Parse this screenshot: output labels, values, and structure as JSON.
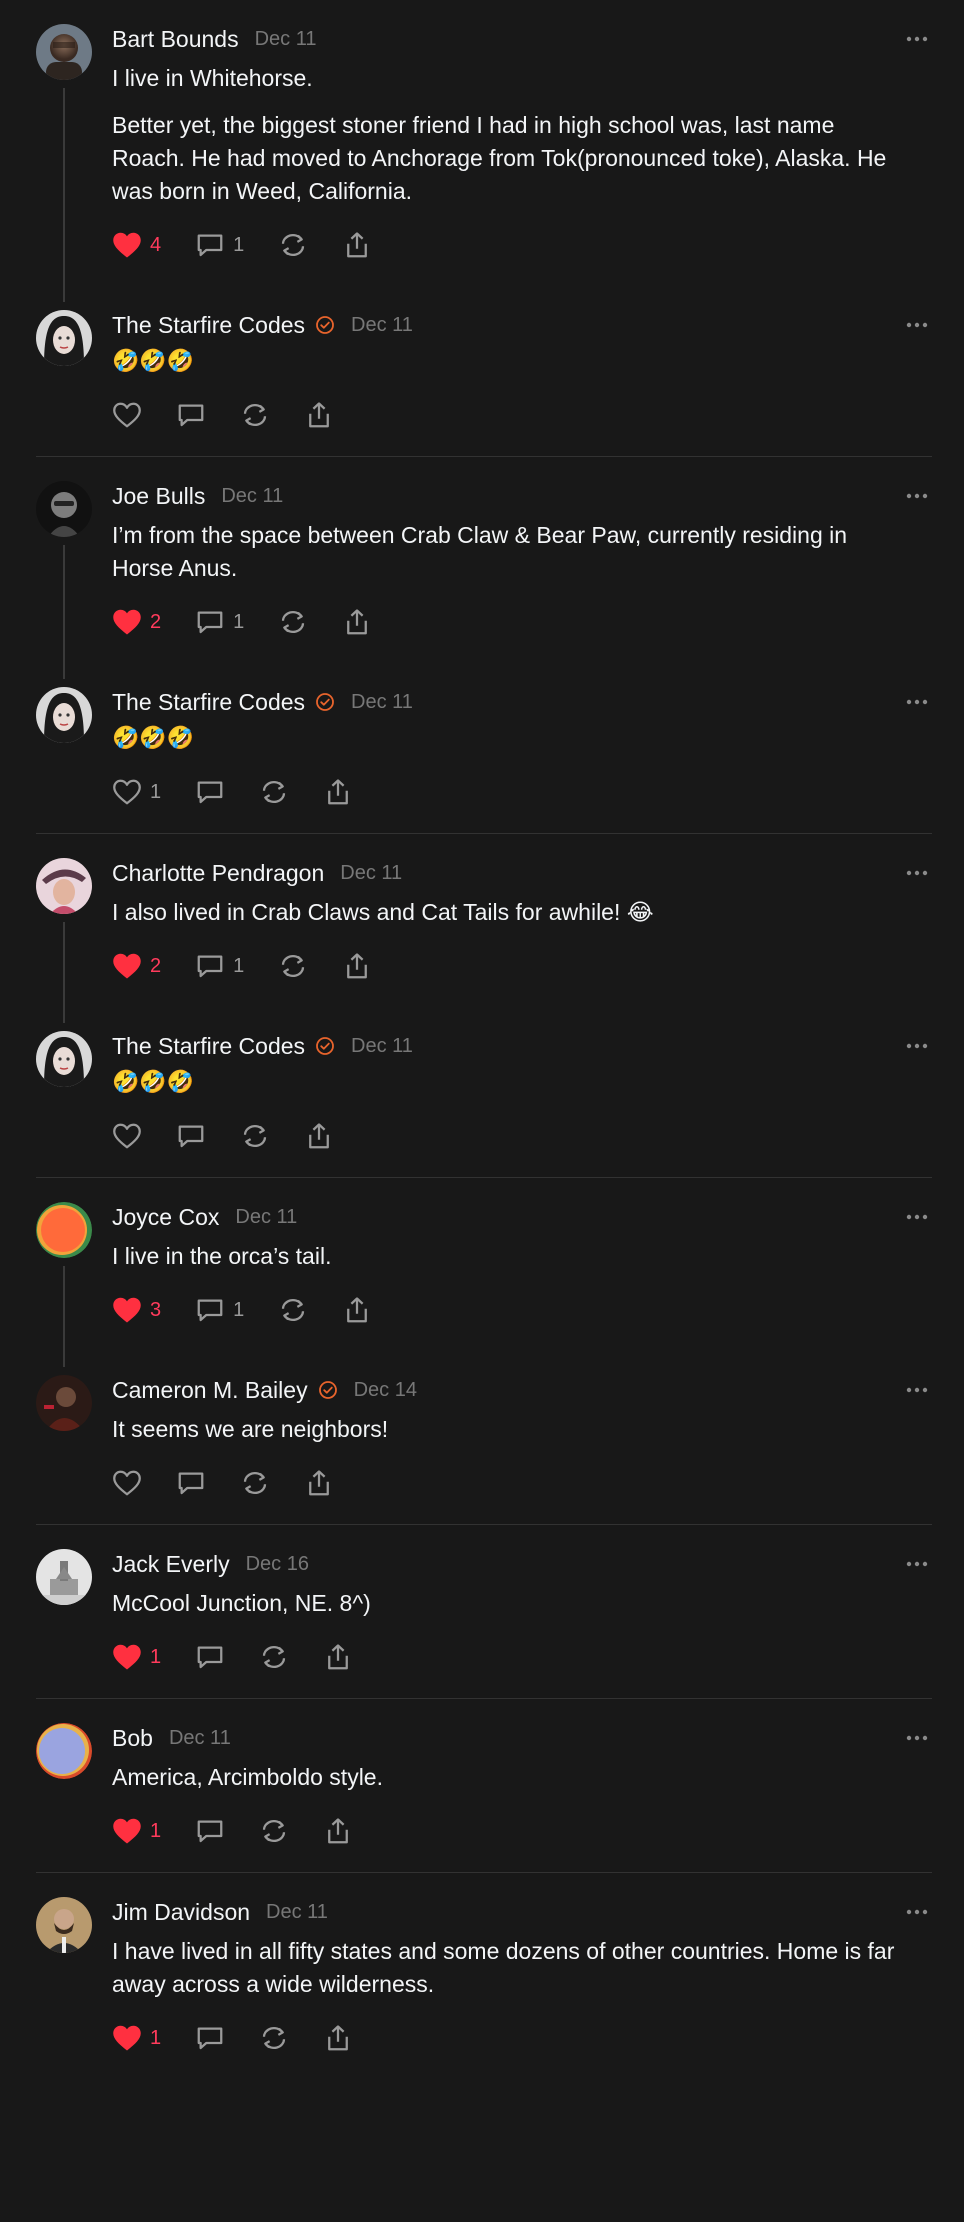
{
  "colors": {
    "background": "#181818",
    "like": "#ff3040",
    "verified": "#e8642c",
    "muted": "#777777"
  },
  "threads": [
    {
      "posts": [
        {
          "author": "Bart Bounds",
          "date": "Dec 11",
          "verified": false,
          "text": [
            "I live in Whitehorse.",
            "Better yet, the biggest stoner friend I had in high school was, last name Roach. He had moved to Anchorage from Tok(pronounced toke), Alaska. He was born in Weed, California."
          ],
          "likes": "4",
          "liked": true,
          "replies": "1"
        },
        {
          "author": "The Starfire Codes",
          "date": "Dec 11",
          "verified": true,
          "text": [
            "🤣🤣🤣"
          ],
          "likes": "",
          "liked": false,
          "replies": ""
        }
      ]
    },
    {
      "posts": [
        {
          "author": "Joe Bulls",
          "date": "Dec 11",
          "verified": false,
          "text": [
            "I’m from the space between Crab Claw & Bear Paw, currently residing in Horse Anus."
          ],
          "likes": "2",
          "liked": true,
          "replies": "1"
        },
        {
          "author": "The Starfire Codes",
          "date": "Dec 11",
          "verified": true,
          "text": [
            "🤣🤣🤣"
          ],
          "likes": "1",
          "liked": false,
          "replies": ""
        }
      ]
    },
    {
      "posts": [
        {
          "author": "Charlotte Pendragon",
          "date": "Dec 11",
          "verified": false,
          "text": [
            "I also lived in Crab Claws and Cat Tails for awhile! 😂"
          ],
          "likes": "2",
          "liked": true,
          "replies": "1"
        },
        {
          "author": "The Starfire Codes",
          "date": "Dec 11",
          "verified": true,
          "text": [
            "🤣🤣🤣"
          ],
          "likes": "",
          "liked": false,
          "replies": ""
        }
      ]
    },
    {
      "posts": [
        {
          "author": "Joyce Cox",
          "date": "Dec 11",
          "verified": false,
          "text": [
            "I live in the orca’s tail."
          ],
          "likes": "3",
          "liked": true,
          "replies": "1"
        },
        {
          "author": "Cameron M. Bailey",
          "date": "Dec 14",
          "verified": true,
          "text": [
            "It seems we are neighbors!"
          ],
          "likes": "",
          "liked": false,
          "replies": ""
        }
      ]
    },
    {
      "posts": [
        {
          "author": "Jack Everly",
          "date": "Dec 16",
          "verified": false,
          "text": [
            "McCool Junction, NE. 8^)"
          ],
          "likes": "1",
          "liked": true,
          "replies": ""
        }
      ]
    },
    {
      "posts": [
        {
          "author": "Bob",
          "date": "Dec 11",
          "verified": false,
          "text": [
            "America, Arcimboldo style."
          ],
          "likes": "1",
          "liked": true,
          "replies": ""
        }
      ]
    },
    {
      "posts": [
        {
          "author": "Jim Davidson",
          "date": "Dec 11",
          "verified": false,
          "text": [
            "I have lived in all fifty states and some dozens of other countries. Home is far away across a wide wilderness."
          ],
          "likes": "1",
          "liked": true,
          "replies": ""
        }
      ]
    }
  ],
  "icons": {
    "like": "heart-icon",
    "reply": "comment-bubble-icon",
    "repost": "repost-icon",
    "share": "share-icon",
    "more": "more-dots-icon",
    "verified": "verified-badge-icon"
  }
}
